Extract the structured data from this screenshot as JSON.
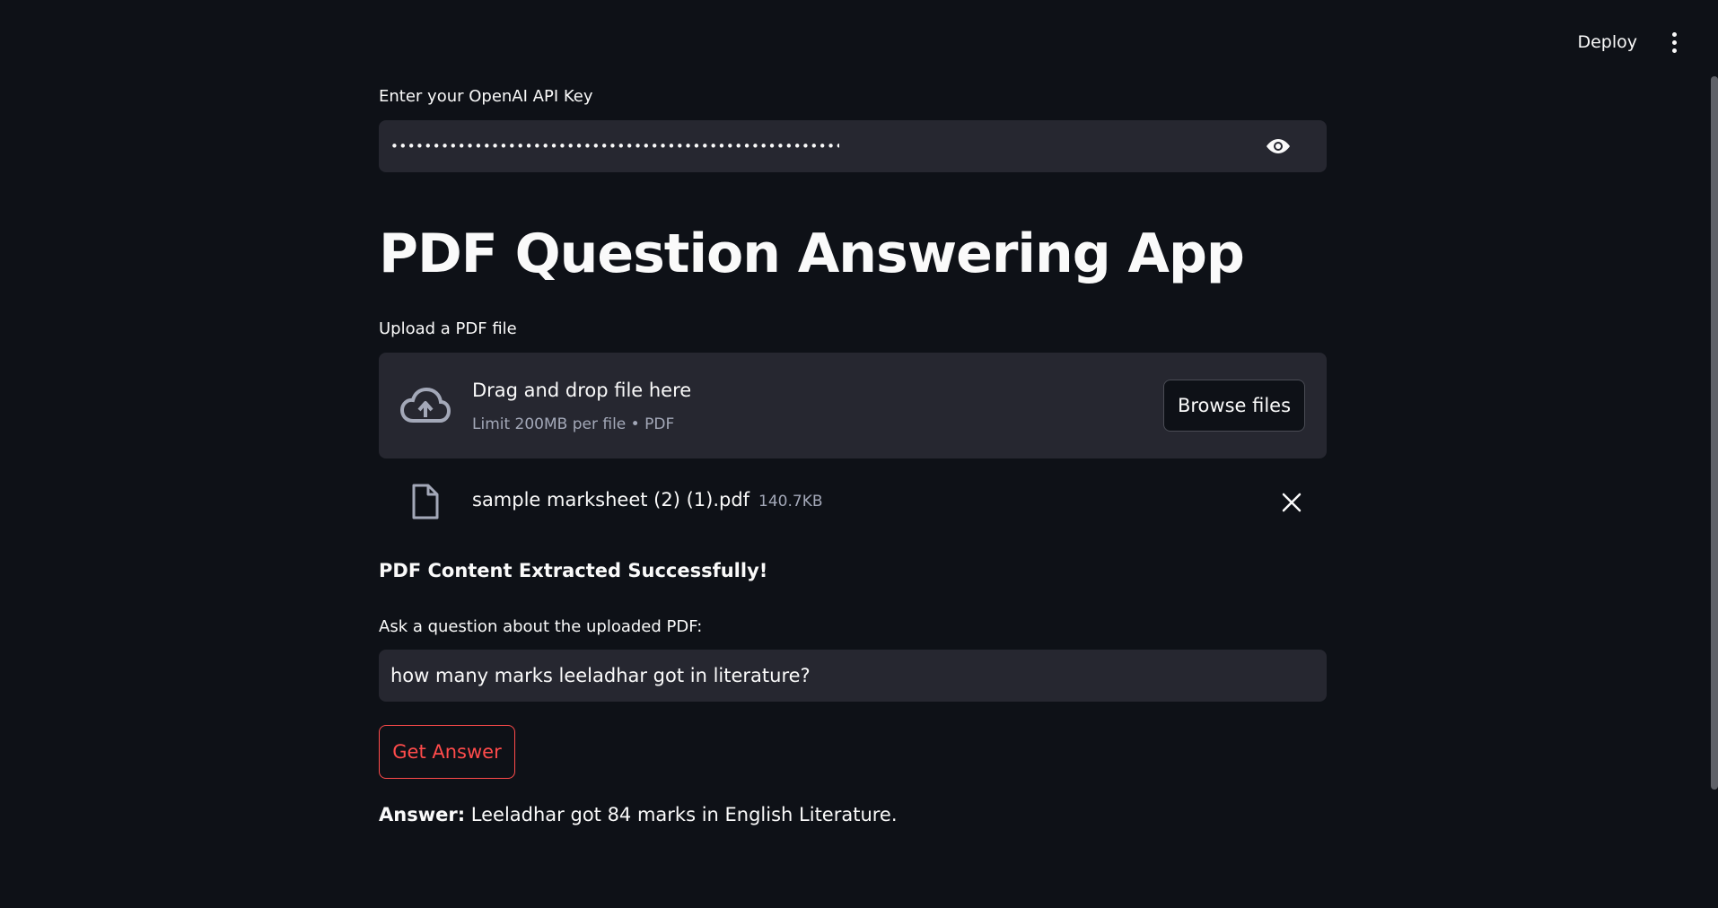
{
  "header": {
    "deploy_label": "Deploy",
    "menu_icon": "kebab-menu-icon"
  },
  "api_key": {
    "label": "Enter your OpenAI API Key",
    "value_masked": "••••••••••••••••••••••••••••••••••••••••••••••••••••••••••••••••••••••••••••••••",
    "toggle_icon": "eye-icon"
  },
  "title": "PDF Question Answering App",
  "upload": {
    "label": "Upload a PDF file",
    "drag_text": "Drag and drop file here",
    "limit_text": "Limit 200MB per file • PDF",
    "browse_label": "Browse files",
    "icon": "cloud-upload-icon"
  },
  "uploaded_file": {
    "name": "sample marksheet (2) (1).pdf",
    "size": "140.7KB",
    "icon": "file-icon",
    "remove_icon": "close-icon"
  },
  "status": {
    "message": "PDF Content Extracted Successfully!"
  },
  "question": {
    "label": "Ask a question about the uploaded PDF:",
    "value": "how many marks leeladhar got in literature?"
  },
  "actions": {
    "get_answer_label": "Get Answer"
  },
  "answer": {
    "prefix": "Answer:",
    "text": "Leeladhar got 84 marks in English Literature."
  },
  "colors": {
    "background": "#0e1117",
    "input_bg": "#262730",
    "accent": "#ff4b4b",
    "text": "#fafafa",
    "muted": "#a3a8b8"
  }
}
